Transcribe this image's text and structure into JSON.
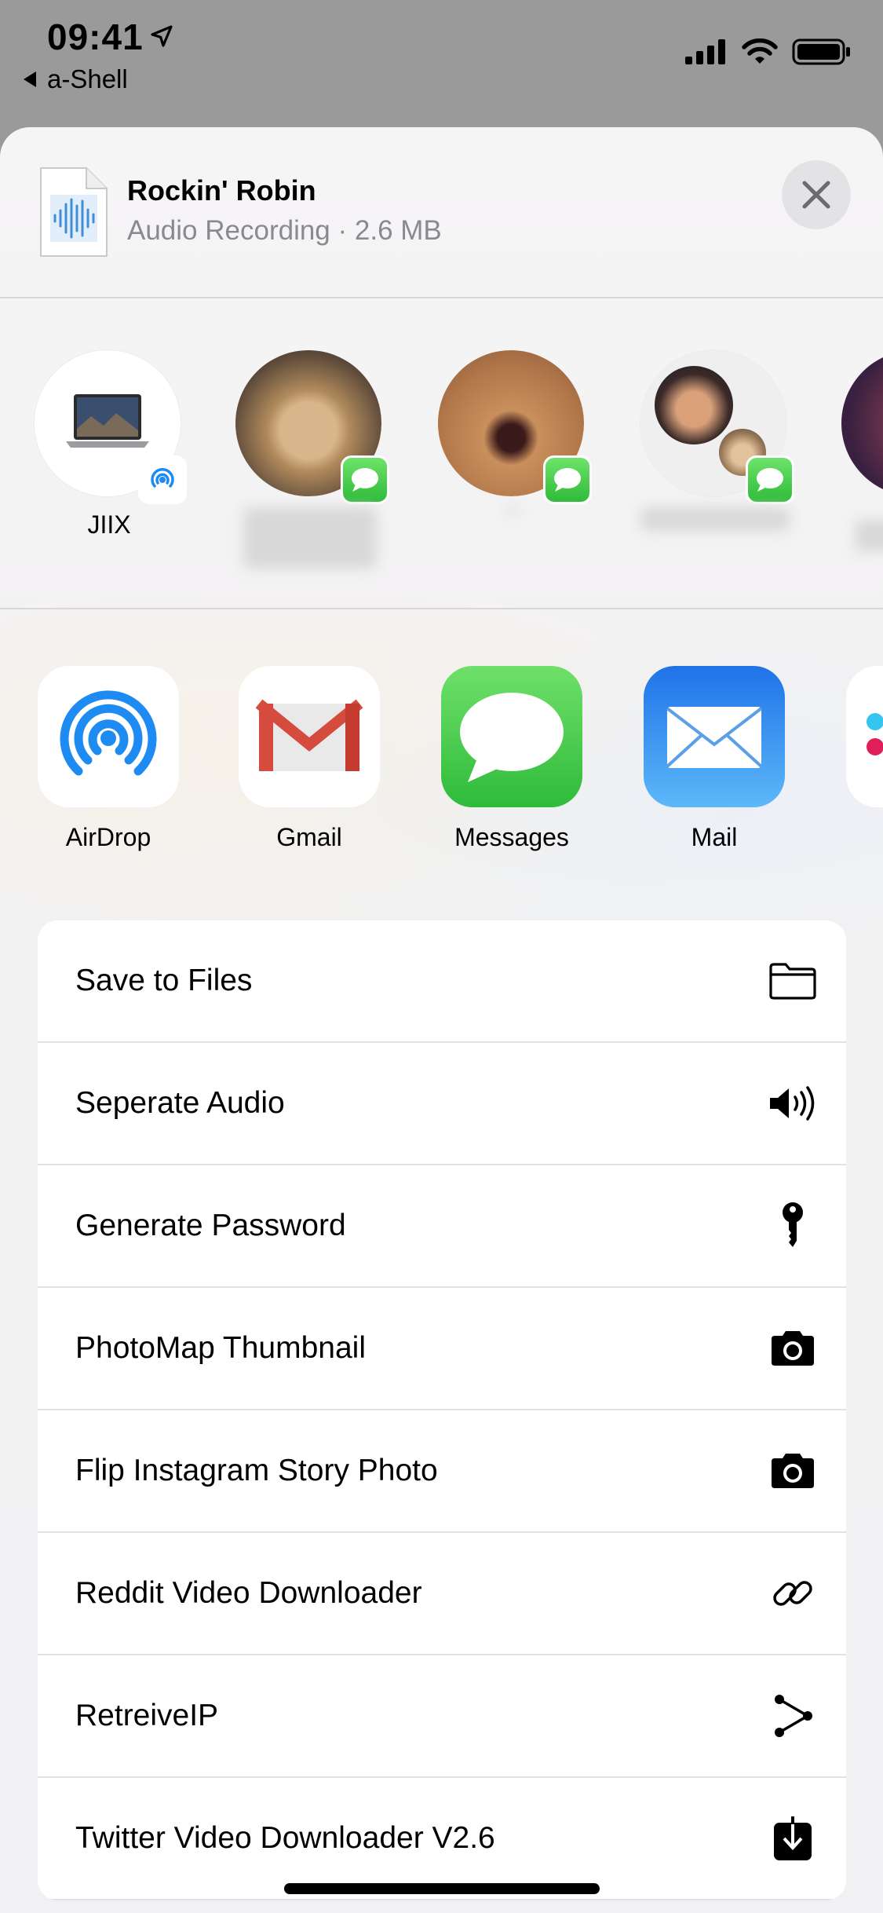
{
  "status_bar": {
    "time": "09:41",
    "back_app": "a-Shell"
  },
  "header": {
    "file_title": "Rockin' Robin",
    "file_subtitle": "Audio Recording · 2.6 MB"
  },
  "people": [
    {
      "label": "JIIX",
      "badge": "airdrop-icon"
    },
    {
      "label": "",
      "badge": "messages-icon"
    },
    {
      "label": "",
      "badge": "messages-icon"
    },
    {
      "label": "",
      "badge": "messages-icon"
    }
  ],
  "apps": [
    {
      "label": "AirDrop",
      "icon": "airdrop-icon"
    },
    {
      "label": "Gmail",
      "icon": "gmail-icon"
    },
    {
      "label": "Messages",
      "icon": "messages-icon"
    },
    {
      "label": "Mail",
      "icon": "mail-icon"
    }
  ],
  "actions": [
    {
      "label": "Save to Files",
      "icon": "folder-icon"
    },
    {
      "label": "Seperate Audio",
      "icon": "speaker-icon"
    },
    {
      "label": "Generate Password",
      "icon": "key-icon"
    },
    {
      "label": "PhotoMap Thumbnail",
      "icon": "camera-icon"
    },
    {
      "label": "Flip Instagram Story Photo",
      "icon": "camera-icon"
    },
    {
      "label": "Reddit Video Downloader",
      "icon": "link-icon"
    },
    {
      "label": "RetreiveIP",
      "icon": "share-nodes-icon"
    },
    {
      "label": "Twitter Video Downloader V2.6",
      "icon": "download-icon"
    }
  ],
  "colors": {
    "messages_green": "#34c759",
    "mail_blue": "#3b8cf0",
    "airdrop_blue": "#1d8bf2",
    "gmail_red": "#d54b3d"
  }
}
